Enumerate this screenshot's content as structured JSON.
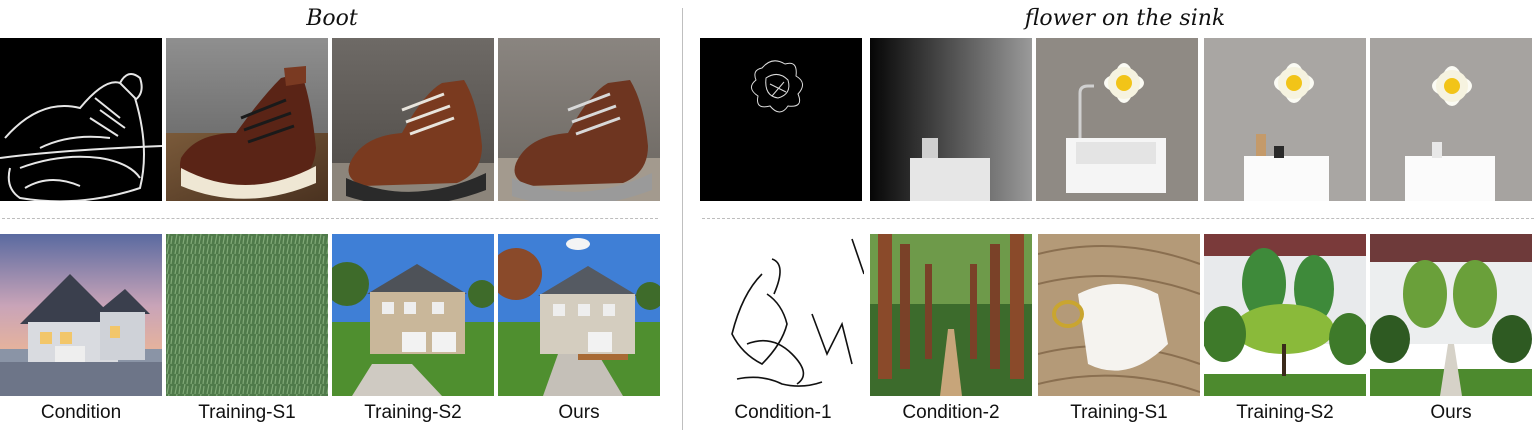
{
  "left_panel": {
    "title": "Boot",
    "captions": [
      "Condition",
      "Training-S1",
      "Training-S2",
      "Ours"
    ]
  },
  "right_panel": {
    "title": "flower on the sink",
    "captions": [
      "Condition-1",
      "Condition-2",
      "Training-S1",
      "Training-S2",
      "Ours"
    ]
  }
}
